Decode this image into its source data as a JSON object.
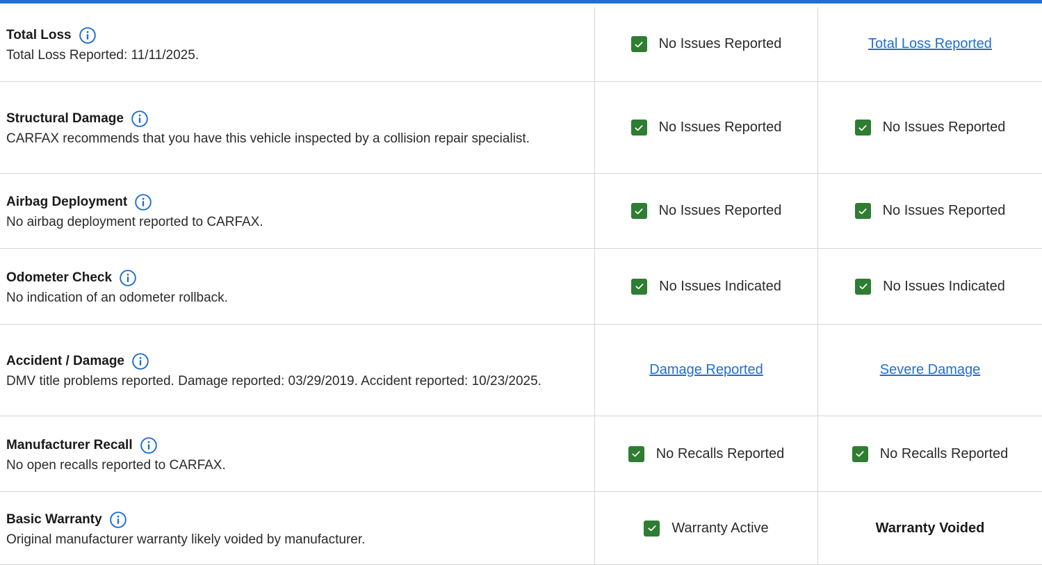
{
  "rows": [
    {
      "title": "Total Loss",
      "description": "Total Loss Reported: 11/11/2025.",
      "col_a": {
        "kind": "check",
        "text": "No Issues Reported"
      },
      "col_b": {
        "kind": "link",
        "text": "Total Loss Reported"
      }
    },
    {
      "title": "Structural Damage",
      "description": "CARFAX recommends that you have this vehicle inspected by a collision repair specialist.",
      "col_a": {
        "kind": "check",
        "text": "No Issues Reported"
      },
      "col_b": {
        "kind": "check",
        "text": "No Issues Reported"
      }
    },
    {
      "title": "Airbag Deployment",
      "description": "No airbag deployment reported to CARFAX.",
      "col_a": {
        "kind": "check",
        "text": "No Issues Reported"
      },
      "col_b": {
        "kind": "check",
        "text": "No Issues Reported"
      }
    },
    {
      "title": "Odometer Check",
      "description": "No indication of an odometer rollback.",
      "col_a": {
        "kind": "check",
        "text": "No Issues Indicated"
      },
      "col_b": {
        "kind": "check",
        "text": "No Issues Indicated"
      }
    },
    {
      "title": "Accident / Damage",
      "description": "DMV title problems reported. Damage reported: 03/29/2019. Accident reported: 10/23/2025.",
      "col_a": {
        "kind": "link",
        "text": "Damage Reported"
      },
      "col_b": {
        "kind": "link",
        "text": "Severe Damage"
      }
    },
    {
      "title": "Manufacturer Recall",
      "description": "No open recalls reported to CARFAX.",
      "col_a": {
        "kind": "check",
        "text": "No Recalls Reported"
      },
      "col_b": {
        "kind": "check",
        "text": "No Recalls Reported"
      }
    },
    {
      "title": "Basic Warranty",
      "description": "Original manufacturer warranty likely voided by manufacturer.",
      "col_a": {
        "kind": "check",
        "text": "Warranty Active"
      },
      "col_b": {
        "kind": "bold",
        "text": "Warranty Voided"
      }
    }
  ],
  "icons": {
    "info": "info-circle-icon",
    "check": "checkmark-icon"
  },
  "colors": {
    "accent": "#1f6fd0",
    "check_green": "#2e7d32",
    "divider": "#d6d6d6"
  }
}
